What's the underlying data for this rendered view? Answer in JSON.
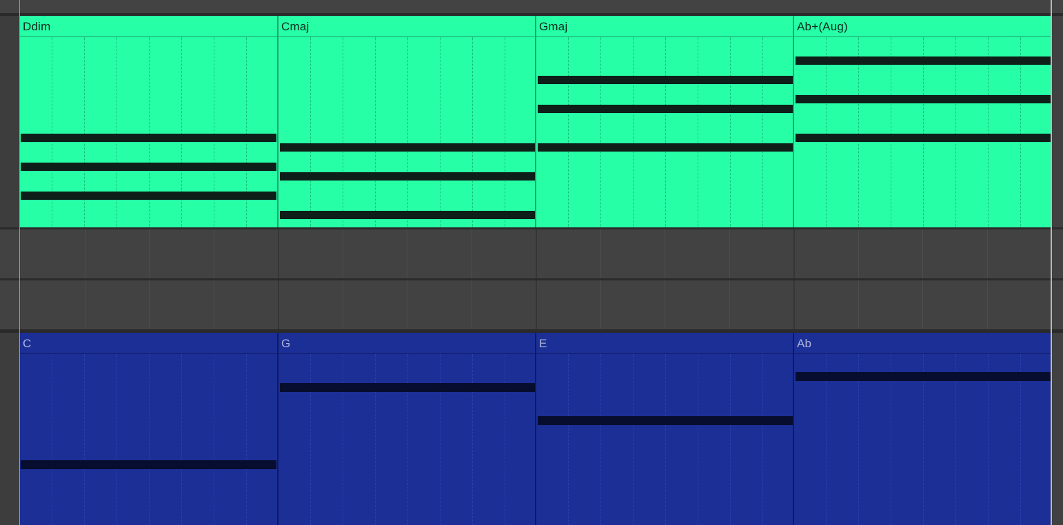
{
  "arrangement": {
    "chord_track": {
      "color": "#27ffa6",
      "clips": [
        {
          "label": "Ddim"
        },
        {
          "label": "Cmaj"
        },
        {
          "label": "Gmaj"
        },
        {
          "label": "Ab+(Aug)"
        }
      ]
    },
    "bass_track": {
      "color": "#1b2f96",
      "clips": [
        {
          "label": "C"
        },
        {
          "label": "G"
        },
        {
          "label": "E"
        },
        {
          "label": "Ab"
        }
      ]
    }
  }
}
